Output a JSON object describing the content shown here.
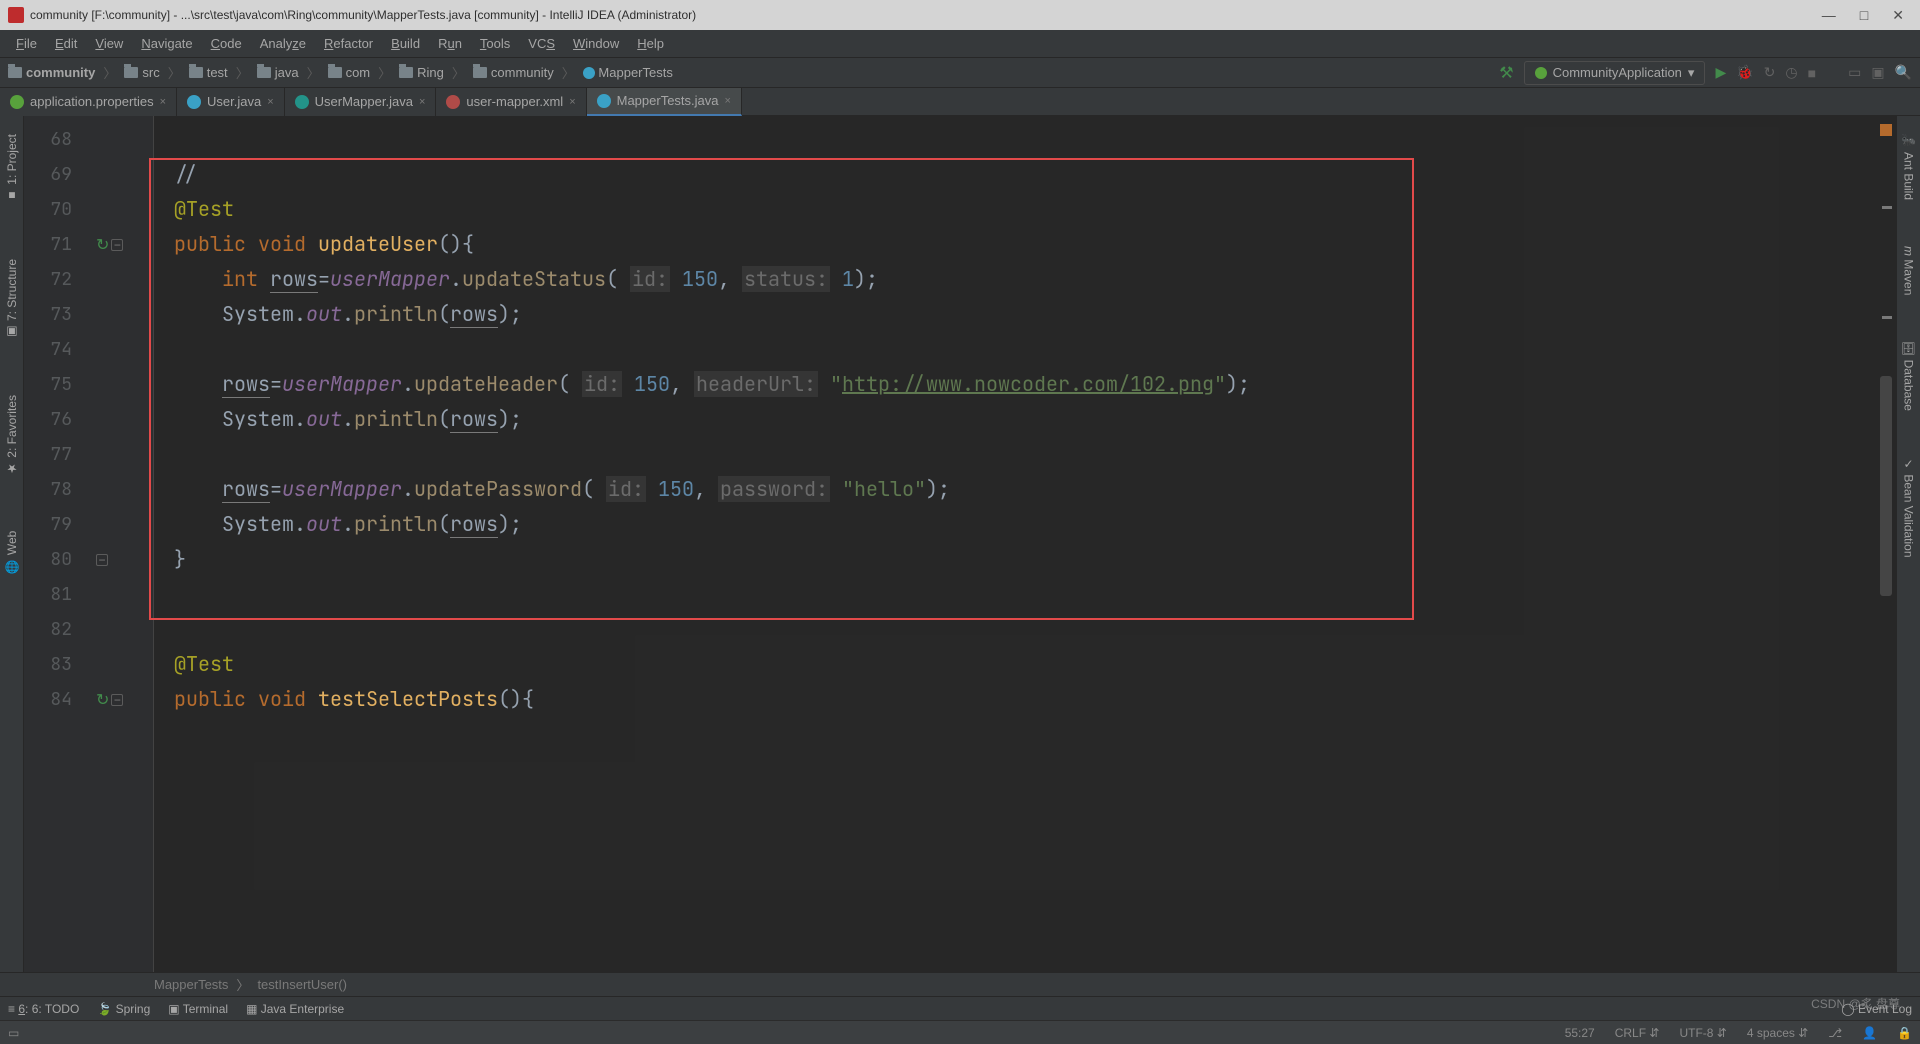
{
  "title": "community [F:\\community] - ...\\src\\test\\java\\com\\Ring\\community\\MapperTests.java [community] - IntelliJ IDEA (Administrator)",
  "menus": [
    "File",
    "Edit",
    "View",
    "Navigate",
    "Code",
    "Analyze",
    "Refactor",
    "Build",
    "Run",
    "Tools",
    "VCS",
    "Window",
    "Help"
  ],
  "breadcrumbs": [
    "community",
    "src",
    "test",
    "java",
    "com",
    "Ring",
    "community",
    "MapperTests"
  ],
  "run_config": "CommunityApplication",
  "tabs": [
    {
      "label": "application.properties",
      "icon": "ic-green",
      "active": false
    },
    {
      "label": "User.java",
      "icon": "ic-blue",
      "active": false
    },
    {
      "label": "UserMapper.java",
      "icon": "ic-teal",
      "active": false
    },
    {
      "label": "user-mapper.xml",
      "icon": "ic-xml",
      "active": false
    },
    {
      "label": "MapperTests.java",
      "icon": "ic-blue",
      "active": true
    }
  ],
  "left_tabs": [
    "1: Project",
    "7: Structure",
    "2: Favorites",
    "Web"
  ],
  "right_tabs": [
    "Ant Build",
    "Maven",
    "Database",
    "Bean Validation"
  ],
  "lines": [
    "68",
    "69",
    "70",
    "71",
    "72",
    "73",
    "74",
    "75",
    "76",
    "77",
    "78",
    "79",
    "80",
    "81",
    "82",
    "83",
    "84"
  ],
  "code": {
    "l69": "//",
    "anno": "@Test",
    "kw_public": "public",
    "kw_void": "void",
    "kw_int": "int",
    "m_updateUser": "updateUser",
    "m_updateStatus": "updateStatus",
    "m_updateHeader": "updateHeader",
    "m_updatePassword": "updatePassword",
    "m_println": "println",
    "m_testSelectPosts": "testSelectPosts",
    "rows": "rows",
    "userMapper": "userMapper",
    "sys": "System",
    "out": "out",
    "p_id": "id:",
    "p_status": "status:",
    "p_headerUrl": "headerUrl:",
    "p_password": "password:",
    "n150": "150",
    "n1": "1",
    "url": "http://www.nowcoder.com/102.png",
    "hello": "hello"
  },
  "editor_crumbs": [
    "MapperTests",
    "testInsertUser()"
  ],
  "bottom": [
    "6: TODO",
    "Spring",
    "Terminal",
    "Java Enterprise"
  ],
  "event_log": "Event Log",
  "status": {
    "pos": "55:27",
    "crlf": "CRLF",
    "enc": "UTF-8",
    "indent": "4 spaces"
  },
  "watermark": "CSDN @炙 盘尊"
}
